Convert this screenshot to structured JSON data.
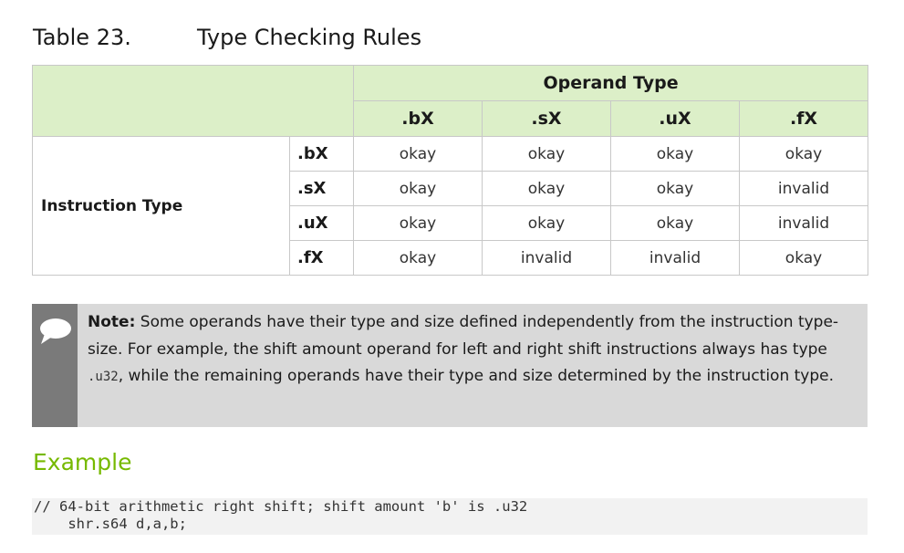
{
  "caption": {
    "number": "Table 23.",
    "title": "Type Checking Rules"
  },
  "table": {
    "group_header": "Operand Type",
    "operand_types": [
      ".bX",
      ".sX",
      ".uX",
      ".fX"
    ],
    "row_group_label": "Instruction Type",
    "rows": [
      {
        "type": ".bX",
        "cells": [
          "okay",
          "okay",
          "okay",
          "okay"
        ]
      },
      {
        "type": ".sX",
        "cells": [
          "okay",
          "okay",
          "okay",
          "invalid"
        ]
      },
      {
        "type": ".uX",
        "cells": [
          "okay",
          "okay",
          "okay",
          "invalid"
        ]
      },
      {
        "type": ".fX",
        "cells": [
          "okay",
          "invalid",
          "invalid",
          "okay"
        ]
      }
    ]
  },
  "note": {
    "icon": "speech-bubble-icon",
    "label": "Note:",
    "text_before_code": " Some operands have their type and size defined independently from the instruction type-size. For example, the shift amount operand for left and right shift instructions always has type ",
    "code": ".u32",
    "text_after_code": ", while the remaining operands have their type and size determined by the instruction type."
  },
  "example": {
    "heading": "Example",
    "code_lines": [
      "// 64-bit arithmetic right shift; shift amount 'b' is .u32",
      "    shr.s64 d,a,b;"
    ]
  },
  "colors": {
    "header_bg": "#dcefc8",
    "note_bg": "#d9d9d9",
    "note_bar": "#7a7a7a",
    "example_heading": "#76b900",
    "code_bg": "#f2f2f2"
  }
}
